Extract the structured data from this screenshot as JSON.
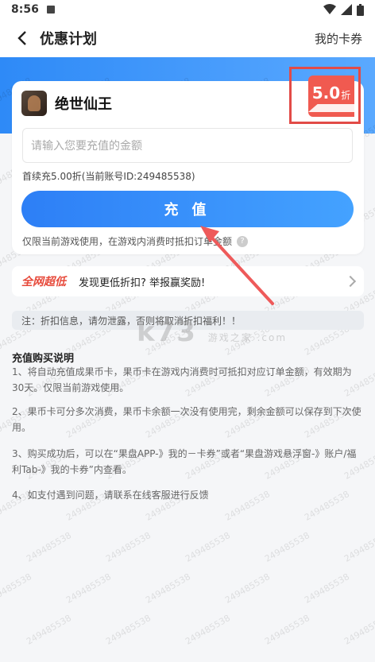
{
  "status_bar": {
    "time": "8:56"
  },
  "nav": {
    "title": "优惠计划",
    "right_link": "我的卡券"
  },
  "game": {
    "name": "绝世仙王"
  },
  "discount": {
    "value": "5.0",
    "unit": "折"
  },
  "input": {
    "placeholder": "请输入您要充值的金额",
    "value": ""
  },
  "account_info": "首续充5.00折(当前账号ID:249485538)",
  "recharge_button": "充 值",
  "usage_note": "仅限当前游戏使用，在游戏内消费时抵扣订单金额",
  "help": "?",
  "report": {
    "badge": "全网超低",
    "text": "发现更低折扣? 举报赢奖励!"
  },
  "notice": "注：折扣信息，请勿泄露，否则将取消折扣福利！！",
  "purchase_info": {
    "title": "充值购买说明",
    "items": [
      "1、将自动充值成果币卡，果币卡在游戏内消费时可抵扣对应订单金额，有效期为30天。仅限当前游戏使用。",
      "2、果币卡可分多次消费，果币卡余额一次没有使用完，剩余金额可以保存到下次使用。",
      "3、购买成功后，可以在“果盘APP-》我的－卡券”或者“果盘游戏悬浮窗-》账户/福利Tab-》我的卡券”内查看。",
      "4、如支付遇到问题，请联系在线客服进行反馈"
    ]
  },
  "watermark_text": "249485538",
  "logo": {
    "main": "k73",
    "sub": "游戏之家 .com"
  },
  "colors": {
    "brand_blue": "#2e8af7",
    "discount_red": "#f05a50",
    "highlight": "#e24b47"
  }
}
